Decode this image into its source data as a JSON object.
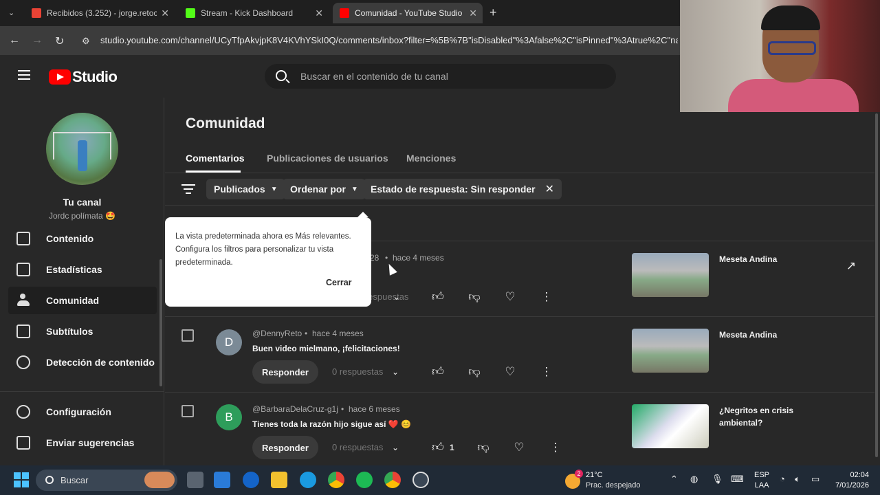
{
  "browser": {
    "tabs": [
      {
        "label": "Recibidos (3.252) - jorge.retoc1",
        "favicon_color": "#ea4335"
      },
      {
        "label": "Stream - Kick Dashboard",
        "favicon_color": "#53fc18"
      },
      {
        "label": "Comunidad - YouTube Studio",
        "favicon_color": "#ff0000"
      }
    ],
    "new_tab": "+",
    "url": "studio.youtube.com/channel/UCyTfpAkvjpK8V4KVhYSkI0Q/comments/inbox?filter=%5B%7B\"isDisabled\"%3Afalse%2C\"isPinned\"%3Atrue%2C\"nam"
  },
  "studio": {
    "logo_text": "Studio",
    "search_placeholder": "Buscar en el contenido de tu canal"
  },
  "sidebar": {
    "channel_name": "Tu canal",
    "channel_handle": "Jordc polímata 🤩",
    "items": [
      {
        "label": "Contenido",
        "icon": "content-icon"
      },
      {
        "label": "Estadísticas",
        "icon": "analytics-icon"
      },
      {
        "label": "Comunidad",
        "icon": "community-icon",
        "active": true
      },
      {
        "label": "Subtítulos",
        "icon": "subtitles-icon"
      },
      {
        "label": "Detección de contenido",
        "icon": "copyright-icon"
      },
      {
        "label": "Configuración",
        "icon": "settings-icon"
      },
      {
        "label": "Enviar sugerencias",
        "icon": "feedback-icon"
      }
    ]
  },
  "main": {
    "title": "Comunidad",
    "tabs": [
      "Comentarios",
      "Publicaciones de usuarios",
      "Menciones"
    ],
    "filters": {
      "published": "Publicados",
      "sort": "Ordenar por",
      "reply_status": "Estado de respuesta: Sin responder"
    },
    "popup": {
      "text": "La vista predeterminada ahora es Más relevantes. Configura los filtros para personalizar tu vista predeterminada.",
      "close": "Cerrar"
    },
    "comments": [
      {
        "author_fragment": "28",
        "time": "hace 4 meses",
        "replies": "0 respuestas",
        "video_title": "Meseta Andina"
      },
      {
        "avatar_letter": "D",
        "avatar_color": "#7b8a96",
        "author": "@DennyReto",
        "time": "hace 4 meses",
        "text": "Buen video mielmano, ¡felicitaciones!",
        "reply_label": "Responder",
        "replies": "0 respuestas",
        "video_title": "Meseta Andina"
      },
      {
        "avatar_letter": "B",
        "avatar_color": "#2e9d5b",
        "author": "@BarbaraDelaCruz-g1j",
        "time": "hace 6 meses",
        "text": "Tienes toda la razón hijo sigue así ❤️ 😊",
        "reply_label": "Responder",
        "replies": "0 respuestas",
        "like_count": "1",
        "video_title": "¿Negritos en crisis ambiental?"
      }
    ]
  },
  "taskbar": {
    "search_label": "Buscar",
    "weather_temp": "21°C",
    "weather_desc": "Prac. despejado",
    "weather_badge": "2",
    "lang_top": "ESP",
    "lang_bottom": "LAA",
    "time": "02:04",
    "date": "7/01/2026"
  }
}
